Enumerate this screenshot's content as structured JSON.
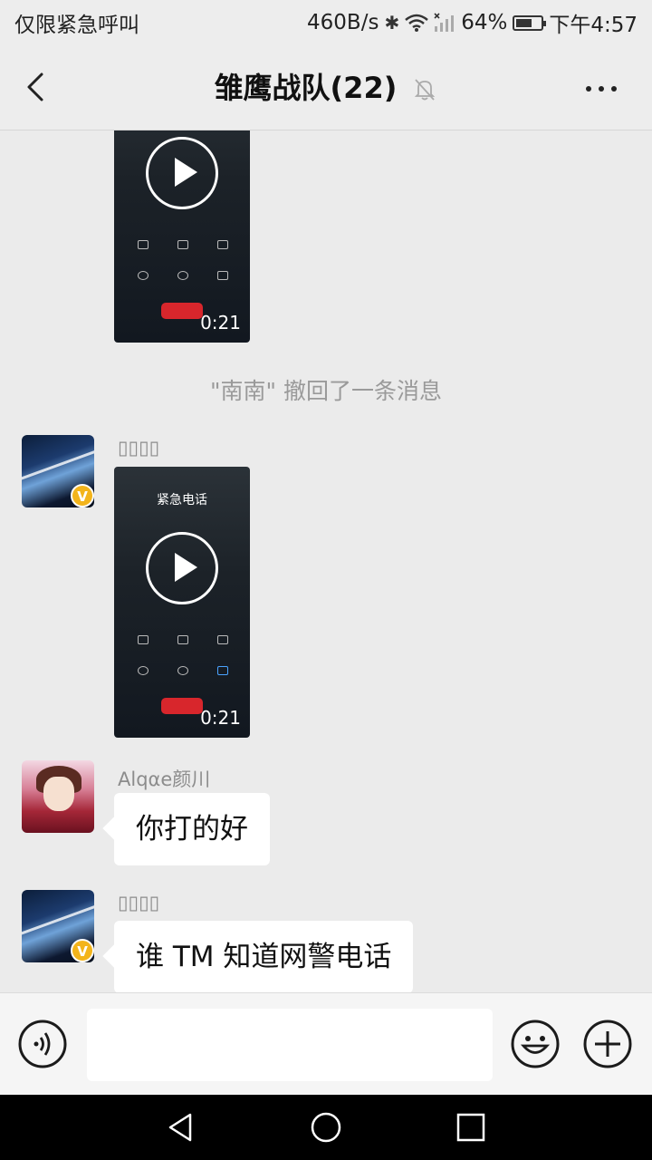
{
  "status_bar": {
    "left_text": "仅限紧急呼叫",
    "speed": "460B/s",
    "battery": "64%",
    "battery_level": 0.64,
    "time": "下午4:57"
  },
  "header": {
    "title": "雏鹰战队(22)"
  },
  "messages": {
    "video_1": {
      "duration": "0:21"
    },
    "recall_text": "\"南南\" 撤回了一条消息",
    "msg_2": {
      "sender": "▯▯▯▯",
      "video": {
        "title": "紧急电话",
        "duration": "0:21"
      }
    },
    "msg_3": {
      "sender": "Alqαe颜川",
      "text": "你打的好"
    },
    "msg_4": {
      "sender": "▯▯▯▯",
      "text": "谁 TM 知道网警电话"
    }
  },
  "colors": {
    "background": "#ebebeb",
    "bubble": "#ffffff",
    "badge": "#f3b41b",
    "hangup": "#d8262c"
  }
}
